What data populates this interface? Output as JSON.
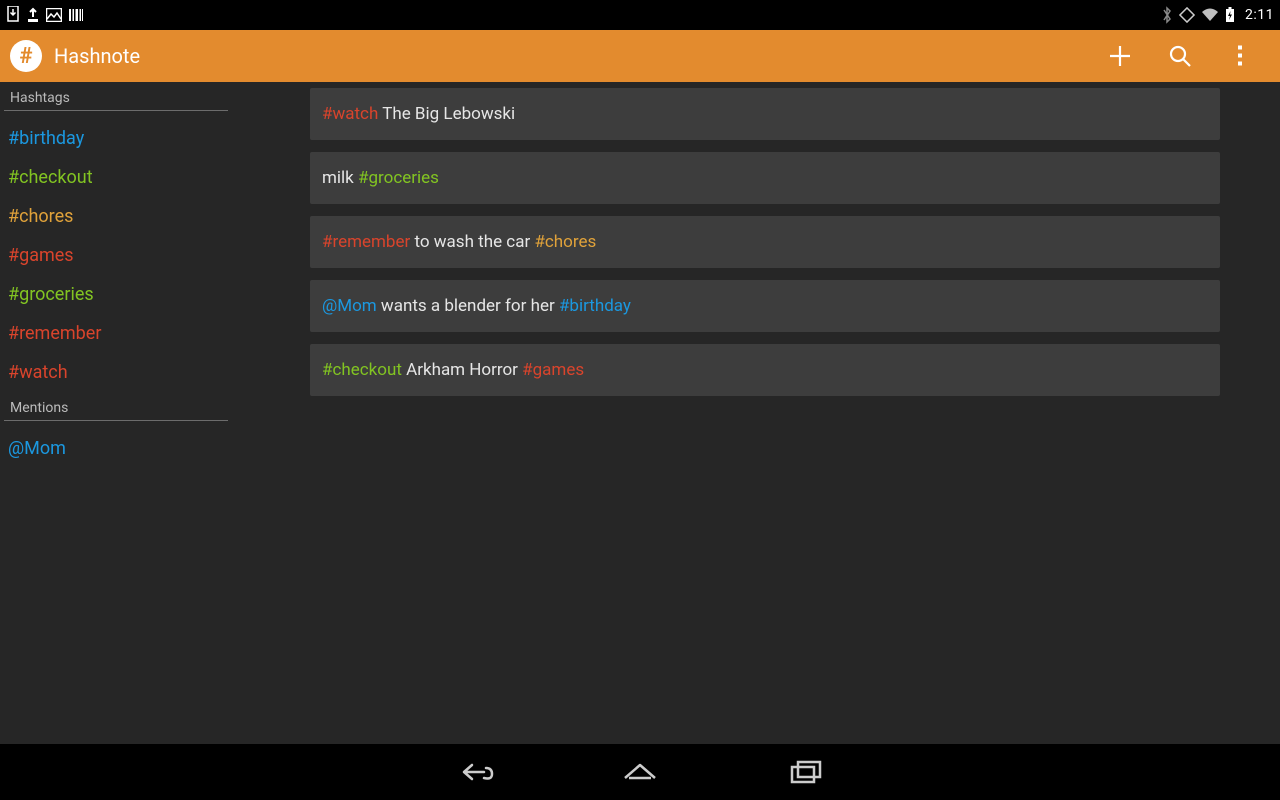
{
  "status_bar": {
    "clock": "2:11"
  },
  "action_bar": {
    "title": "Hashnote"
  },
  "sidebar": {
    "section_hashtags": "Hashtags",
    "section_mentions": "Mentions",
    "hashtags": [
      {
        "label": "#birthday",
        "color": "c-blue"
      },
      {
        "label": "#checkout",
        "color": "c-green"
      },
      {
        "label": "#chores",
        "color": "c-amber"
      },
      {
        "label": "#games",
        "color": "c-red"
      },
      {
        "label": "#groceries",
        "color": "c-green"
      },
      {
        "label": "#remember",
        "color": "c-red"
      },
      {
        "label": "#watch",
        "color": "c-red"
      }
    ],
    "mentions": [
      {
        "label": "@Mom",
        "color": "c-blue"
      }
    ]
  },
  "notes": [
    {
      "segments": [
        {
          "text": "#watch",
          "color": "c-red"
        },
        {
          "text": " The Big Lebowski",
          "color": ""
        }
      ]
    },
    {
      "segments": [
        {
          "text": "milk ",
          "color": ""
        },
        {
          "text": "#groceries",
          "color": "c-green"
        }
      ]
    },
    {
      "segments": [
        {
          "text": "#remember",
          "color": "c-red"
        },
        {
          "text": " to wash the car ",
          "color": ""
        },
        {
          "text": "#chores",
          "color": "c-amber"
        }
      ]
    },
    {
      "segments": [
        {
          "text": "@Mom",
          "color": "c-blue"
        },
        {
          "text": " wants a blender for her ",
          "color": ""
        },
        {
          "text": "#birthday",
          "color": "c-blue"
        }
      ]
    },
    {
      "segments": [
        {
          "text": "#checkout",
          "color": "c-green"
        },
        {
          "text": " Arkham Horror ",
          "color": ""
        },
        {
          "text": "#games",
          "color": "c-red"
        }
      ]
    }
  ]
}
